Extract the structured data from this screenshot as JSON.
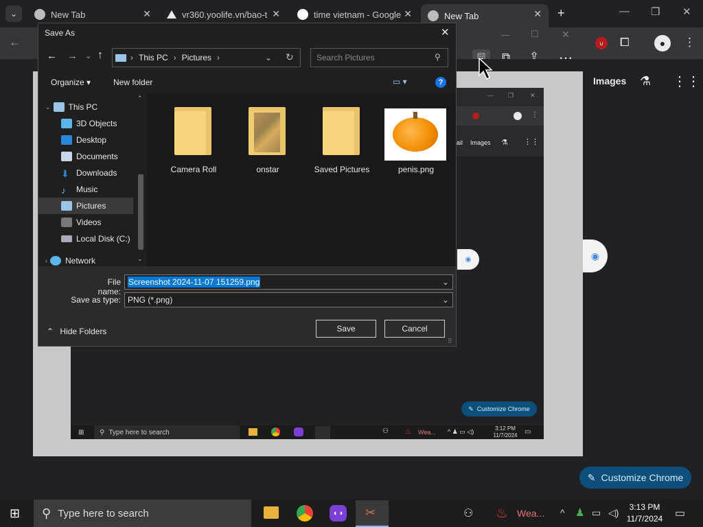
{
  "chrome": {
    "tabs": [
      {
        "title": "New Tab",
        "icon": "chrome-icon",
        "active": false
      },
      {
        "title": "vr360.yoolife.vn/bao-t",
        "icon": "triangle-logo-icon",
        "active": false
      },
      {
        "title": "time vietnam - Google",
        "icon": "google-icon",
        "active": false
      },
      {
        "title": "New Tab",
        "icon": "chrome-icon",
        "active": true
      }
    ],
    "new_tab": "+",
    "toolbar_images_link": "Images"
  },
  "dialog": {
    "title": "Save As",
    "breadcrumb": [
      "This PC",
      "Pictures"
    ],
    "search_placeholder": "Search Pictures",
    "organize_label": "Organize",
    "new_folder_label": "New folder",
    "nav_items": [
      {
        "label": "This PC",
        "icon": "computer-icon",
        "selected": false
      },
      {
        "label": "3D Objects",
        "icon": "cube-icon",
        "selected": false
      },
      {
        "label": "Desktop",
        "icon": "desktop-icon",
        "selected": false
      },
      {
        "label": "Documents",
        "icon": "documents-icon",
        "selected": false
      },
      {
        "label": "Downloads",
        "icon": "download-icon",
        "selected": false
      },
      {
        "label": "Music",
        "icon": "music-icon",
        "selected": false
      },
      {
        "label": "Pictures",
        "icon": "pictures-icon",
        "selected": true
      },
      {
        "label": "Videos",
        "icon": "videos-icon",
        "selected": false
      },
      {
        "label": "Local Disk (C:)",
        "icon": "drive-icon",
        "selected": false
      },
      {
        "label": "Network",
        "icon": "network-icon",
        "selected": false
      }
    ],
    "files": [
      {
        "name": "Camera Roll",
        "kind": "folder"
      },
      {
        "name": "onstar",
        "kind": "folder-with-image"
      },
      {
        "name": "Saved Pictures",
        "kind": "folder"
      },
      {
        "name": "penis.png",
        "kind": "image"
      }
    ],
    "file_name_label": "File name:",
    "file_name_value": "Screenshot 2024-11-07 151259.png",
    "save_type_label": "Save as type:",
    "save_type_value": "PNG (*.png)",
    "hide_folders_label": "Hide Folders",
    "save_button": "Save",
    "cancel_button": "Cancel"
  },
  "page": {
    "inner_images_link": "Images",
    "inner_gmail_fragment": "ail",
    "inner_customize": "Customize Chrome",
    "inner_search_placeholder": "Type here to search",
    "inner_weather": "Wea...",
    "inner_time": "3:12 PM",
    "inner_date": "11/7/2024",
    "customize_chrome": "Customize Chrome"
  },
  "taskbar": {
    "search_placeholder": "Type here to search",
    "weather": "Wea...",
    "time": "3:13 PM",
    "date": "11/7/2024"
  },
  "colors": {
    "accent_pill": "#0b4f7a",
    "selection": "#0078d7",
    "folder": "#f6d57d"
  }
}
